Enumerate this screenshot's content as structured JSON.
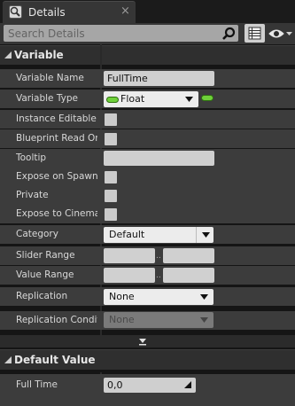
{
  "tab": {
    "title": "Details",
    "close": "×"
  },
  "search": {
    "placeholder": "Search Details"
  },
  "sections": {
    "variable": {
      "title": "Variable"
    },
    "default_value": {
      "title": "Default Value"
    }
  },
  "fields": {
    "variable_name": {
      "label": "Variable Name",
      "value": "FullTime"
    },
    "variable_type": {
      "label": "Variable Type",
      "value": "Float"
    },
    "instance_editable": {
      "label": "Instance Editable"
    },
    "blueprint_read_only": {
      "label": "Blueprint Read Onl"
    },
    "tooltip": {
      "label": "Tooltip",
      "value": ""
    },
    "expose_on_spawn": {
      "label": "Expose on Spawn"
    },
    "private": {
      "label": "Private"
    },
    "expose_to_cinematics": {
      "label": "Expose to Cinemat"
    },
    "category": {
      "label": "Category",
      "value": "Default"
    },
    "slider_range": {
      "label": "Slider Range",
      "separator": ".."
    },
    "value_range": {
      "label": "Value Range",
      "separator": ".."
    },
    "replication": {
      "label": "Replication",
      "value": "None"
    },
    "replication_condition": {
      "label": "Replication Conditi",
      "value": "None"
    },
    "full_time": {
      "label": "Full Time",
      "value": "0,0"
    }
  },
  "colors": {
    "panel_bg": "#3c3c3c",
    "header_bg": "#2f2f2f",
    "float_pin": "#6fd13a"
  },
  "icons": {
    "tab": "details-info-icon",
    "search": "search-icon",
    "view_options": "grid-list-icon",
    "visibility": "eye-icon",
    "expander": "chevron-down-icon"
  }
}
